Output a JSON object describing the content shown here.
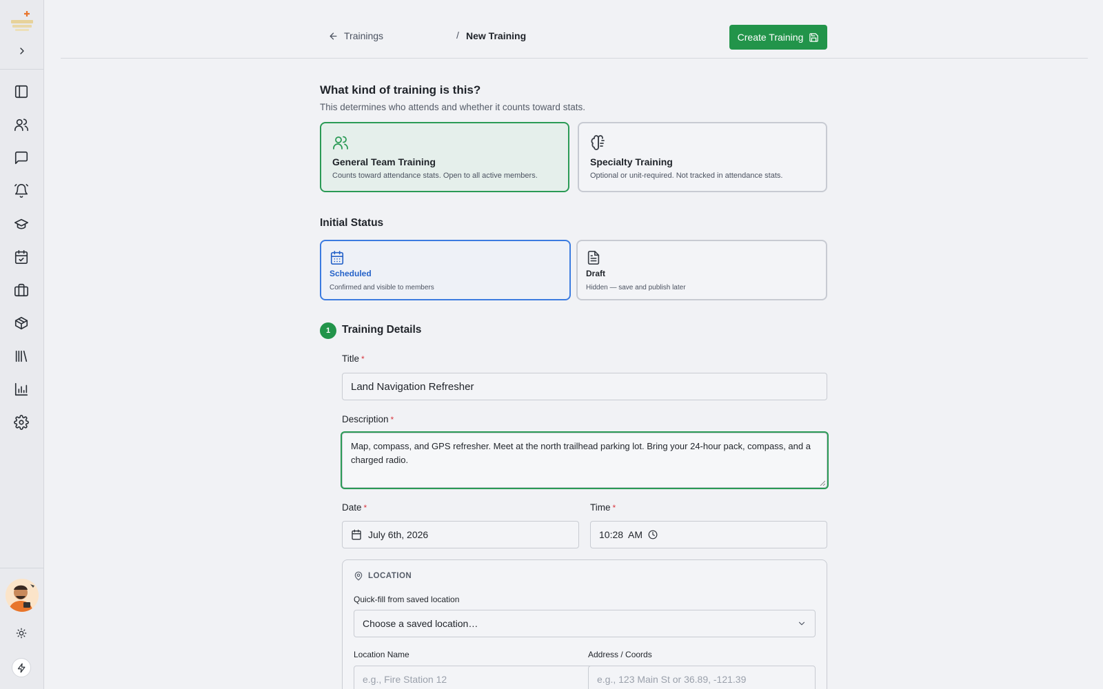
{
  "breadcrumb": {
    "back_label": "Trainings",
    "separator": "/",
    "current": "New Training"
  },
  "header": {
    "create_label": "Create Training"
  },
  "training_type": {
    "question": "What kind of training is this?",
    "subtitle": "This determines who attends and whether it counts toward stats.",
    "options": [
      {
        "title": "General Team Training",
        "desc": "Counts toward attendance stats. Open to all active members.",
        "selected": true
      },
      {
        "title": "Specialty Training",
        "desc": "Optional or unit-required. Not tracked in attendance stats.",
        "selected": false
      }
    ]
  },
  "status": {
    "title": "Initial Status",
    "options": [
      {
        "title": "Scheduled",
        "desc": "Confirmed and visible to members",
        "selected": true
      },
      {
        "title": "Draft",
        "desc": "Hidden — save and publish later",
        "selected": false
      }
    ]
  },
  "details": {
    "step": "1",
    "title": "Training Details",
    "required_mark": "*",
    "title_label": "Title",
    "title_value": "Land Navigation Refresher",
    "description_label": "Description",
    "description_value": "Map, compass, and GPS refresher. Meet at the north trailhead parking lot. Bring your 24-hour pack, compass, and a charged radio.",
    "date_label": "Date",
    "date_value": "July 6th, 2026",
    "time_label": "Time",
    "time_value": "10:28  AM"
  },
  "location": {
    "heading": "LOCATION",
    "quickfill_label": "Quick-fill from saved location",
    "quickfill_value": "Choose a saved location…",
    "name_label": "Location Name",
    "name_placeholder": "e.g., Fire Station 12",
    "address_label": "Address / Coords",
    "address_placeholder": "e.g., 123 Main St or 36.89, -121.39"
  },
  "colors": {
    "accent_green": "#22944a",
    "accent_blue": "#3b7be0",
    "required_red": "#d9363e"
  }
}
